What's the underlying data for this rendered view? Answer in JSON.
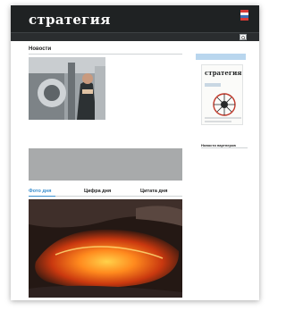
{
  "header": {
    "logo_small": "",
    "logo": "стратегия",
    "contacts_name": "",
    "contacts_lines": [
      "",
      ""
    ],
    "flag_colors": [
      "#d63a35",
      "#f2f2f2",
      "#3b6fb6",
      "#d63a35"
    ]
  },
  "nav": {
    "items": [
      "",
      "",
      "",
      "",
      "",
      "",
      "",
      ""
    ]
  },
  "news": {
    "section_title": "Новости",
    "all_news_label": "",
    "main": {
      "date": "",
      "headline": "",
      "lead": ""
    },
    "list": [
      {
        "date": "",
        "title": "",
        "lead": ""
      },
      {
        "date": "",
        "title": "",
        "lead": ""
      },
      {
        "date": "",
        "title": "",
        "lead": ""
      },
      {
        "date": "",
        "title": "",
        "lead": ""
      }
    ]
  },
  "day_tabs": {
    "photo": "Фото дня",
    "figure": "Цифра дня",
    "quote": "Цитата дня",
    "active_color": "#3a8fcf"
  },
  "lava_caption": "",
  "sidebar": {
    "subscribe_label": "",
    "magazine_title": "стратегия",
    "magazine_subtitle": "",
    "partners_title": "Новости партнеров",
    "partners": [
      {
        "title": "",
        "lead": ""
      },
      {
        "title": "",
        "lead": ""
      },
      {
        "title": "",
        "lead": ""
      },
      {
        "title": "",
        "lead": ""
      }
    ],
    "partners_all_label": ""
  }
}
